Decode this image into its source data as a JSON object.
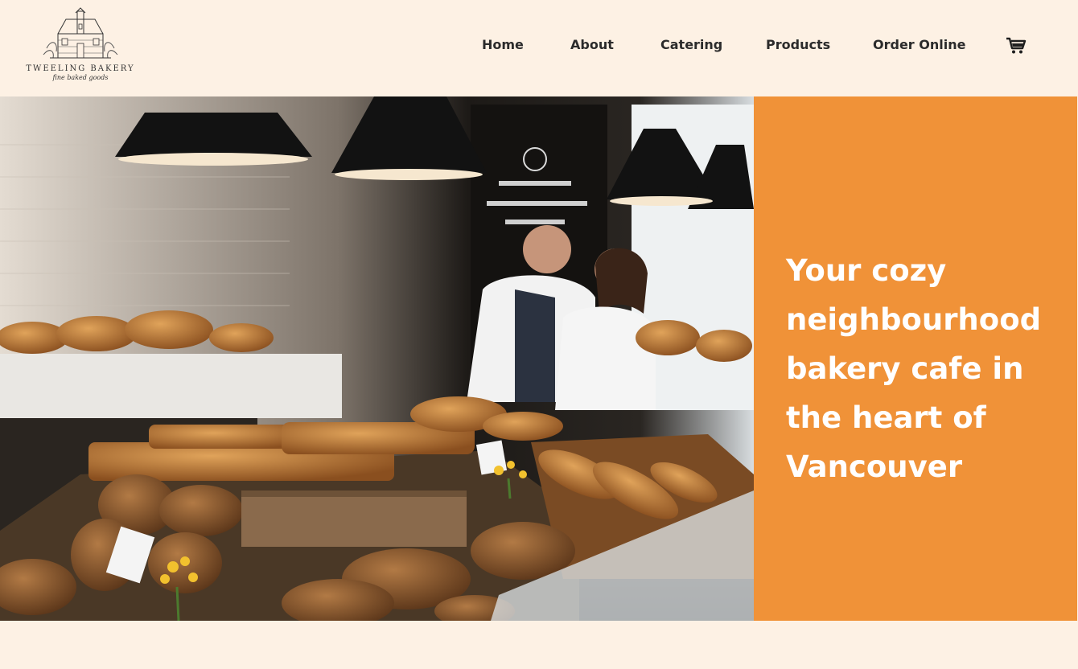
{
  "brand": {
    "name": "TWEELING BAKERY",
    "tagline": "fine baked goods"
  },
  "nav": {
    "items": [
      {
        "label": "Home"
      },
      {
        "label": "About"
      },
      {
        "label": "Catering"
      },
      {
        "label": "Products"
      },
      {
        "label": "Order Online"
      }
    ],
    "cart_icon": "shopping-cart-icon"
  },
  "hero": {
    "headline": "Your cozy neighbourhood bakery cafe in the heart of Vancouver",
    "image_subject": "bakery-counter-photo"
  },
  "colors": {
    "background": "#fdf1e4",
    "accent": "#f09238",
    "text_dark": "#2b2b2b",
    "hero_text": "#ffffff"
  }
}
